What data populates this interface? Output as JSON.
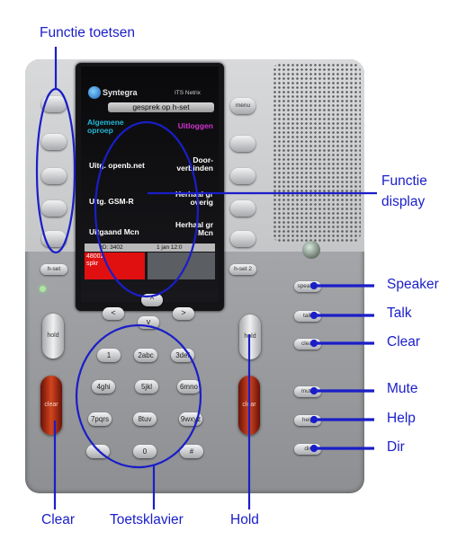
{
  "labels": {
    "functie_toetsen": "Functie toetsen",
    "functie_display_line1": "Functie",
    "functie_display_line2": "display",
    "speaker": "Speaker",
    "talk": "Talk",
    "clear_right": "Clear",
    "mute": "Mute",
    "help": "Help",
    "dir": "Dir",
    "clear_bottom": "Clear",
    "toetsklavier": "Toetsklavier",
    "hold": "Hold"
  },
  "screen": {
    "brand": "Syntegra",
    "product": "ITS Netrix",
    "banner": "gesprek op h-set",
    "left_items": [
      {
        "line1": "Algemene",
        "line2": "oproep",
        "color": "#21b7d6"
      },
      {
        "line1": "Uitg. openb.net",
        "line2": "",
        "color": "#ffffff"
      },
      {
        "line1": "Uitg. GSM-R",
        "line2": "",
        "color": "#ffffff"
      },
      {
        "line1": "Uitgaand Mcn",
        "line2": "",
        "color": "#ffffff"
      }
    ],
    "right_items": [
      {
        "line1": "Uitloggen",
        "line2": "",
        "color": "#d233d2"
      },
      {
        "line1": "Door-",
        "line2": "verbinden",
        "color": "#ffffff"
      },
      {
        "line1": "Herhaal gr",
        "line2": "overig",
        "color": "#ffffff"
      },
      {
        "line1": "Herhaal gr",
        "line2": "Mcn",
        "color": "#ffffff"
      }
    ],
    "id_text": "ID: 3402",
    "date_text": "1 jan 12:0",
    "call_number": "48002",
    "call_state": "spkr"
  },
  "buttons": {
    "menu": "menu",
    "hset": "h-set",
    "hset2": "h-set 2",
    "speaker": "speaker",
    "talk": "talk",
    "clear": "clear",
    "mute": "mute",
    "help": "help",
    "dir": "dir",
    "hold": "hold",
    "clear_big": "clear",
    "nav_up": "^",
    "nav_left": "<",
    "nav_right": ">",
    "nav_down": "v"
  },
  "keypad": [
    "1",
    "2abc",
    "3def",
    "4ghi",
    "5jkl",
    "6mno",
    "7pqrs",
    "8tuv",
    "9wxyz",
    "*",
    "0",
    "#"
  ],
  "colors": {
    "annotation": "#1a1ec8",
    "red_button": "#c0391b",
    "call_highlight": "#e01010"
  }
}
